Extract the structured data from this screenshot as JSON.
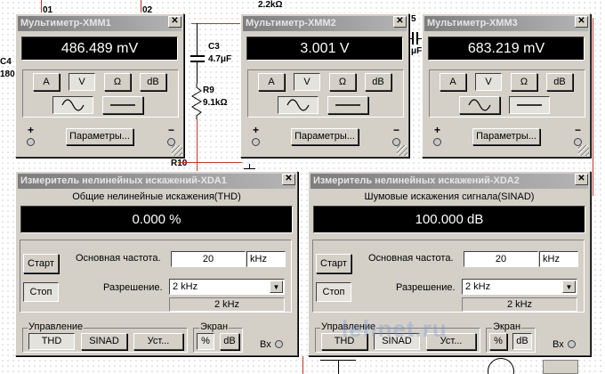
{
  "schematic": {
    "labels": {
      "o1": "01",
      "o2": "02",
      "r_top": "2.2kΩ",
      "c5": "5",
      "c5_val": "μF",
      "c4": "C4",
      "c4_val": "180",
      "c3": "C3",
      "c3_val": "4.7μF",
      "r9": "R9",
      "r9_val": "9.1kΩ",
      "r10": "R10"
    }
  },
  "multimeters": [
    {
      "title": "Мультиметр-XMM1",
      "reading": "486.489 mV",
      "mode_buttons": [
        "A",
        "V",
        "Ω",
        "dB"
      ],
      "active_mode": "V",
      "params_label": "Параметры...",
      "plus": "+",
      "minus": "−"
    },
    {
      "title": "Мультиметр-XMM2",
      "reading": "3.001 V",
      "mode_buttons": [
        "A",
        "V",
        "Ω",
        "dB"
      ],
      "active_mode": "V",
      "params_label": "Параметры...",
      "plus": "+",
      "minus": "−"
    },
    {
      "title": "Мультиметр-XMM3",
      "reading": "683.219 mV",
      "mode_buttons": [
        "A",
        "V",
        "Ω",
        "dB"
      ],
      "active_mode": "V",
      "params_label": "Параметры...",
      "plus": "+",
      "minus": "−"
    }
  ],
  "analyzers": [
    {
      "title": "Измеритель нелинейных искажений-XDA1",
      "caption": "Общие нелинейные искажения(THD)",
      "reading": "0.000 %",
      "start_label": "Старт",
      "stop_label": "Стоп",
      "freq_label": "Основная частота.",
      "freq_value": "20",
      "freq_unit": "kHz",
      "res_label": "Разрешение.",
      "res_value": "2 kHz",
      "res_readout": "2 kHz",
      "control_label": "Управление",
      "control_buttons": [
        "THD",
        "SINAD",
        "Уст..."
      ],
      "screen_label": "Экран",
      "screen_buttons": [
        "%",
        "dB"
      ],
      "input_label": "Вх"
    },
    {
      "title": "Измеритель нелинейных искажений-XDA2",
      "caption": "Шумовые искажения сигнала(SINAD)",
      "reading": "100.000 dB",
      "start_label": "Старт",
      "stop_label": "Стоп",
      "freq_label": "Основная частота.",
      "freq_value": "20",
      "freq_unit": "kHz",
      "res_label": "Разрешение.",
      "res_value": "2 kHz",
      "res_readout": "2 kHz",
      "control_label": "Управление",
      "control_buttons": [
        "THD",
        "SINAD",
        "Уст..."
      ],
      "screen_label": "Экран",
      "screen_buttons": [
        "%",
        "dB"
      ],
      "input_label": "Вх"
    }
  ],
  "watermark": "lehnet.ru"
}
